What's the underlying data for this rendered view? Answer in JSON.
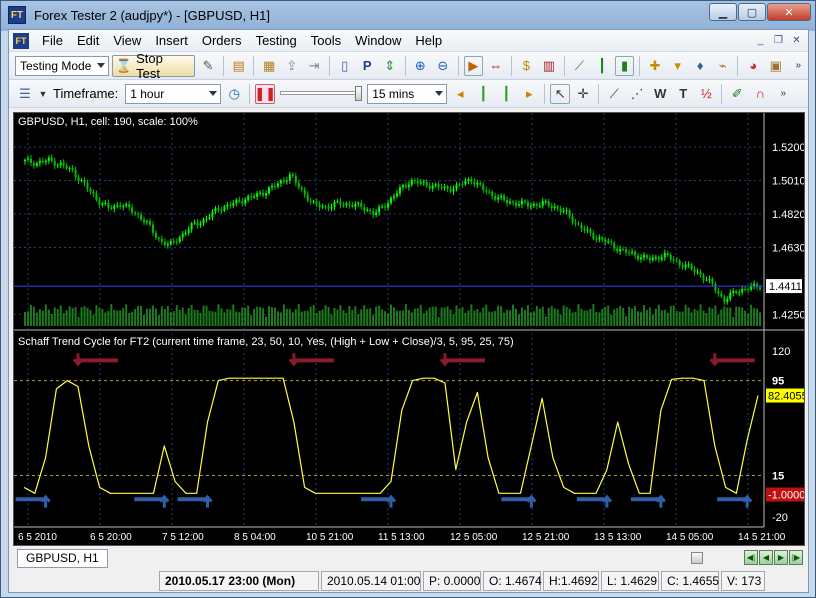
{
  "window": {
    "title": "Forex Tester 2  (audjpy*) - [GBPUSD, H1]",
    "icon_label": "FT",
    "controls": [
      "minimize",
      "maximize",
      "close"
    ]
  },
  "menubar": {
    "items": [
      "File",
      "Edit",
      "View",
      "Insert",
      "Orders",
      "Testing",
      "Tools",
      "Window",
      "Help"
    ]
  },
  "toolbar1": {
    "mode_value": "Testing Mode",
    "stop_label": "Stop Test"
  },
  "toolbar2": {
    "timeframe_label": "Timeframe:",
    "timeframe_value": "1 hour",
    "speed_value": "15 mins"
  },
  "price_chart": {
    "header": "GBPUSD, H1, cell: 190, scale: 100%",
    "y_ticks": [
      "1.5200",
      "1.5010",
      "1.4820",
      "1.4630",
      "1.4250"
    ],
    "y_tick_values": [
      1.52,
      1.501,
      1.482,
      1.463,
      1.425
    ],
    "current_price": "1.4411",
    "current_price_value": 1.4411,
    "ylim": [
      1.419,
      1.528
    ],
    "close_series": [
      1.512,
      1.511,
      1.5125,
      1.51,
      1.506,
      1.498,
      1.49,
      1.485,
      1.488,
      1.483,
      1.478,
      1.468,
      1.464,
      1.47,
      1.476,
      1.479,
      1.485,
      1.487,
      1.49,
      1.492,
      1.495,
      1.499,
      1.504,
      1.495,
      1.487,
      1.486,
      1.488,
      1.4875,
      1.486,
      1.482,
      1.488,
      1.495,
      1.501,
      1.499,
      1.498,
      1.496,
      1.498,
      1.502,
      1.496,
      1.492,
      1.489,
      1.488,
      1.487,
      1.488,
      1.486,
      1.482,
      1.475,
      1.47,
      1.467,
      1.463,
      1.46,
      1.458,
      1.456,
      1.459,
      1.455,
      1.452,
      1.448,
      1.442,
      1.433,
      1.438,
      1.44,
      1.441
    ]
  },
  "stc_chart": {
    "header": "Schaff Trend Cycle for FT2 (current time frame, 23, 50, 10, Yes, (High + Low + Close)/3, 5, 95, 25, 75)",
    "y_ticks": [
      "120",
      "95",
      "15",
      "-20"
    ],
    "y_tick_values": [
      120,
      95,
      15,
      -20
    ],
    "current_value": "82.4055",
    "current_value_num": 82.4055,
    "marker_value": "-1.00000",
    "marker_value_num": -1.0,
    "ylim": [
      -25,
      125
    ],
    "series": [
      5,
      0,
      30,
      88,
      95,
      90,
      40,
      5,
      0,
      0,
      0,
      0,
      0,
      40,
      10,
      0,
      0,
      60,
      95,
      97,
      97,
      97,
      97,
      97,
      97,
      60,
      5,
      0,
      0,
      0,
      0,
      0,
      0,
      0,
      10,
      70,
      95,
      97,
      97,
      93,
      20,
      60,
      85,
      30,
      0,
      0,
      0,
      40,
      80,
      30,
      5,
      0,
      0,
      0,
      20,
      60,
      25,
      0,
      0,
      70,
      96,
      97,
      97,
      95,
      40,
      5,
      0,
      45,
      82.4055
    ]
  },
  "time_axis": {
    "labels": [
      "6 5 2010",
      "6 5 20:00",
      "7 5 12:00",
      "8 5 04:00",
      "10 5 21:00",
      "11 5 13:00",
      "12 5 05:00",
      "12 5 21:00",
      "13 5 13:00",
      "14 5 05:00",
      "14 5 21:00"
    ]
  },
  "bottom": {
    "symbol_tab": "GBPUSD, H1"
  },
  "status": {
    "datetime": "2010.05.17 23:00 (Mon)",
    "bar_time": "2010.05.14 01:00",
    "p": "P: 0.0000",
    "o": "O: 1.4674",
    "h": "H:1.4692",
    "l": "L: 1.4629",
    "c": "C: 1.4655",
    "v": "V: 173"
  },
  "colors": {
    "bull": "#00ff00",
    "bear": "#00c000",
    "stc_line": "#ffff40",
    "arrow_down": "#8b1a2a",
    "arrow_up": "#2e5fa8",
    "price_line": "#3a3aff"
  }
}
